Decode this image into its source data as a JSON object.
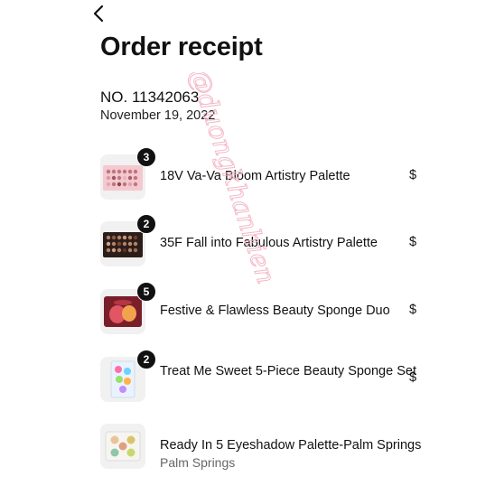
{
  "header": {
    "back_icon": "chevron-left-icon",
    "title": "Order receipt"
  },
  "order": {
    "number": "NO. 11342063",
    "date": "November 19, 2022"
  },
  "items": [
    {
      "qty": "3",
      "name": "18V Va-Va Bloom Artistry Palette",
      "variant": "",
      "price": "$"
    },
    {
      "qty": "2",
      "name": "35F Fall into Fabulous Artistry Palette",
      "variant": "",
      "price": "$"
    },
    {
      "qty": "5",
      "name": "Festive & Flawless Beauty Sponge Duo",
      "variant": "",
      "price": "$"
    },
    {
      "qty": "2",
      "name": "Treat Me Sweet 5-Piece Beauty Sponge Set",
      "variant": "",
      "price": "$"
    },
    {
      "qty": "",
      "name": "Ready In 5 Eyeshadow Palette-Palm Springs",
      "variant": "Palm Springs",
      "price": ""
    }
  ],
  "watermark": {
    "text": "@duongkhanhien"
  },
  "colors": {
    "text": "#111111",
    "muted": "#666666",
    "badge": "#111111",
    "watermark": "#f4b8c8"
  }
}
